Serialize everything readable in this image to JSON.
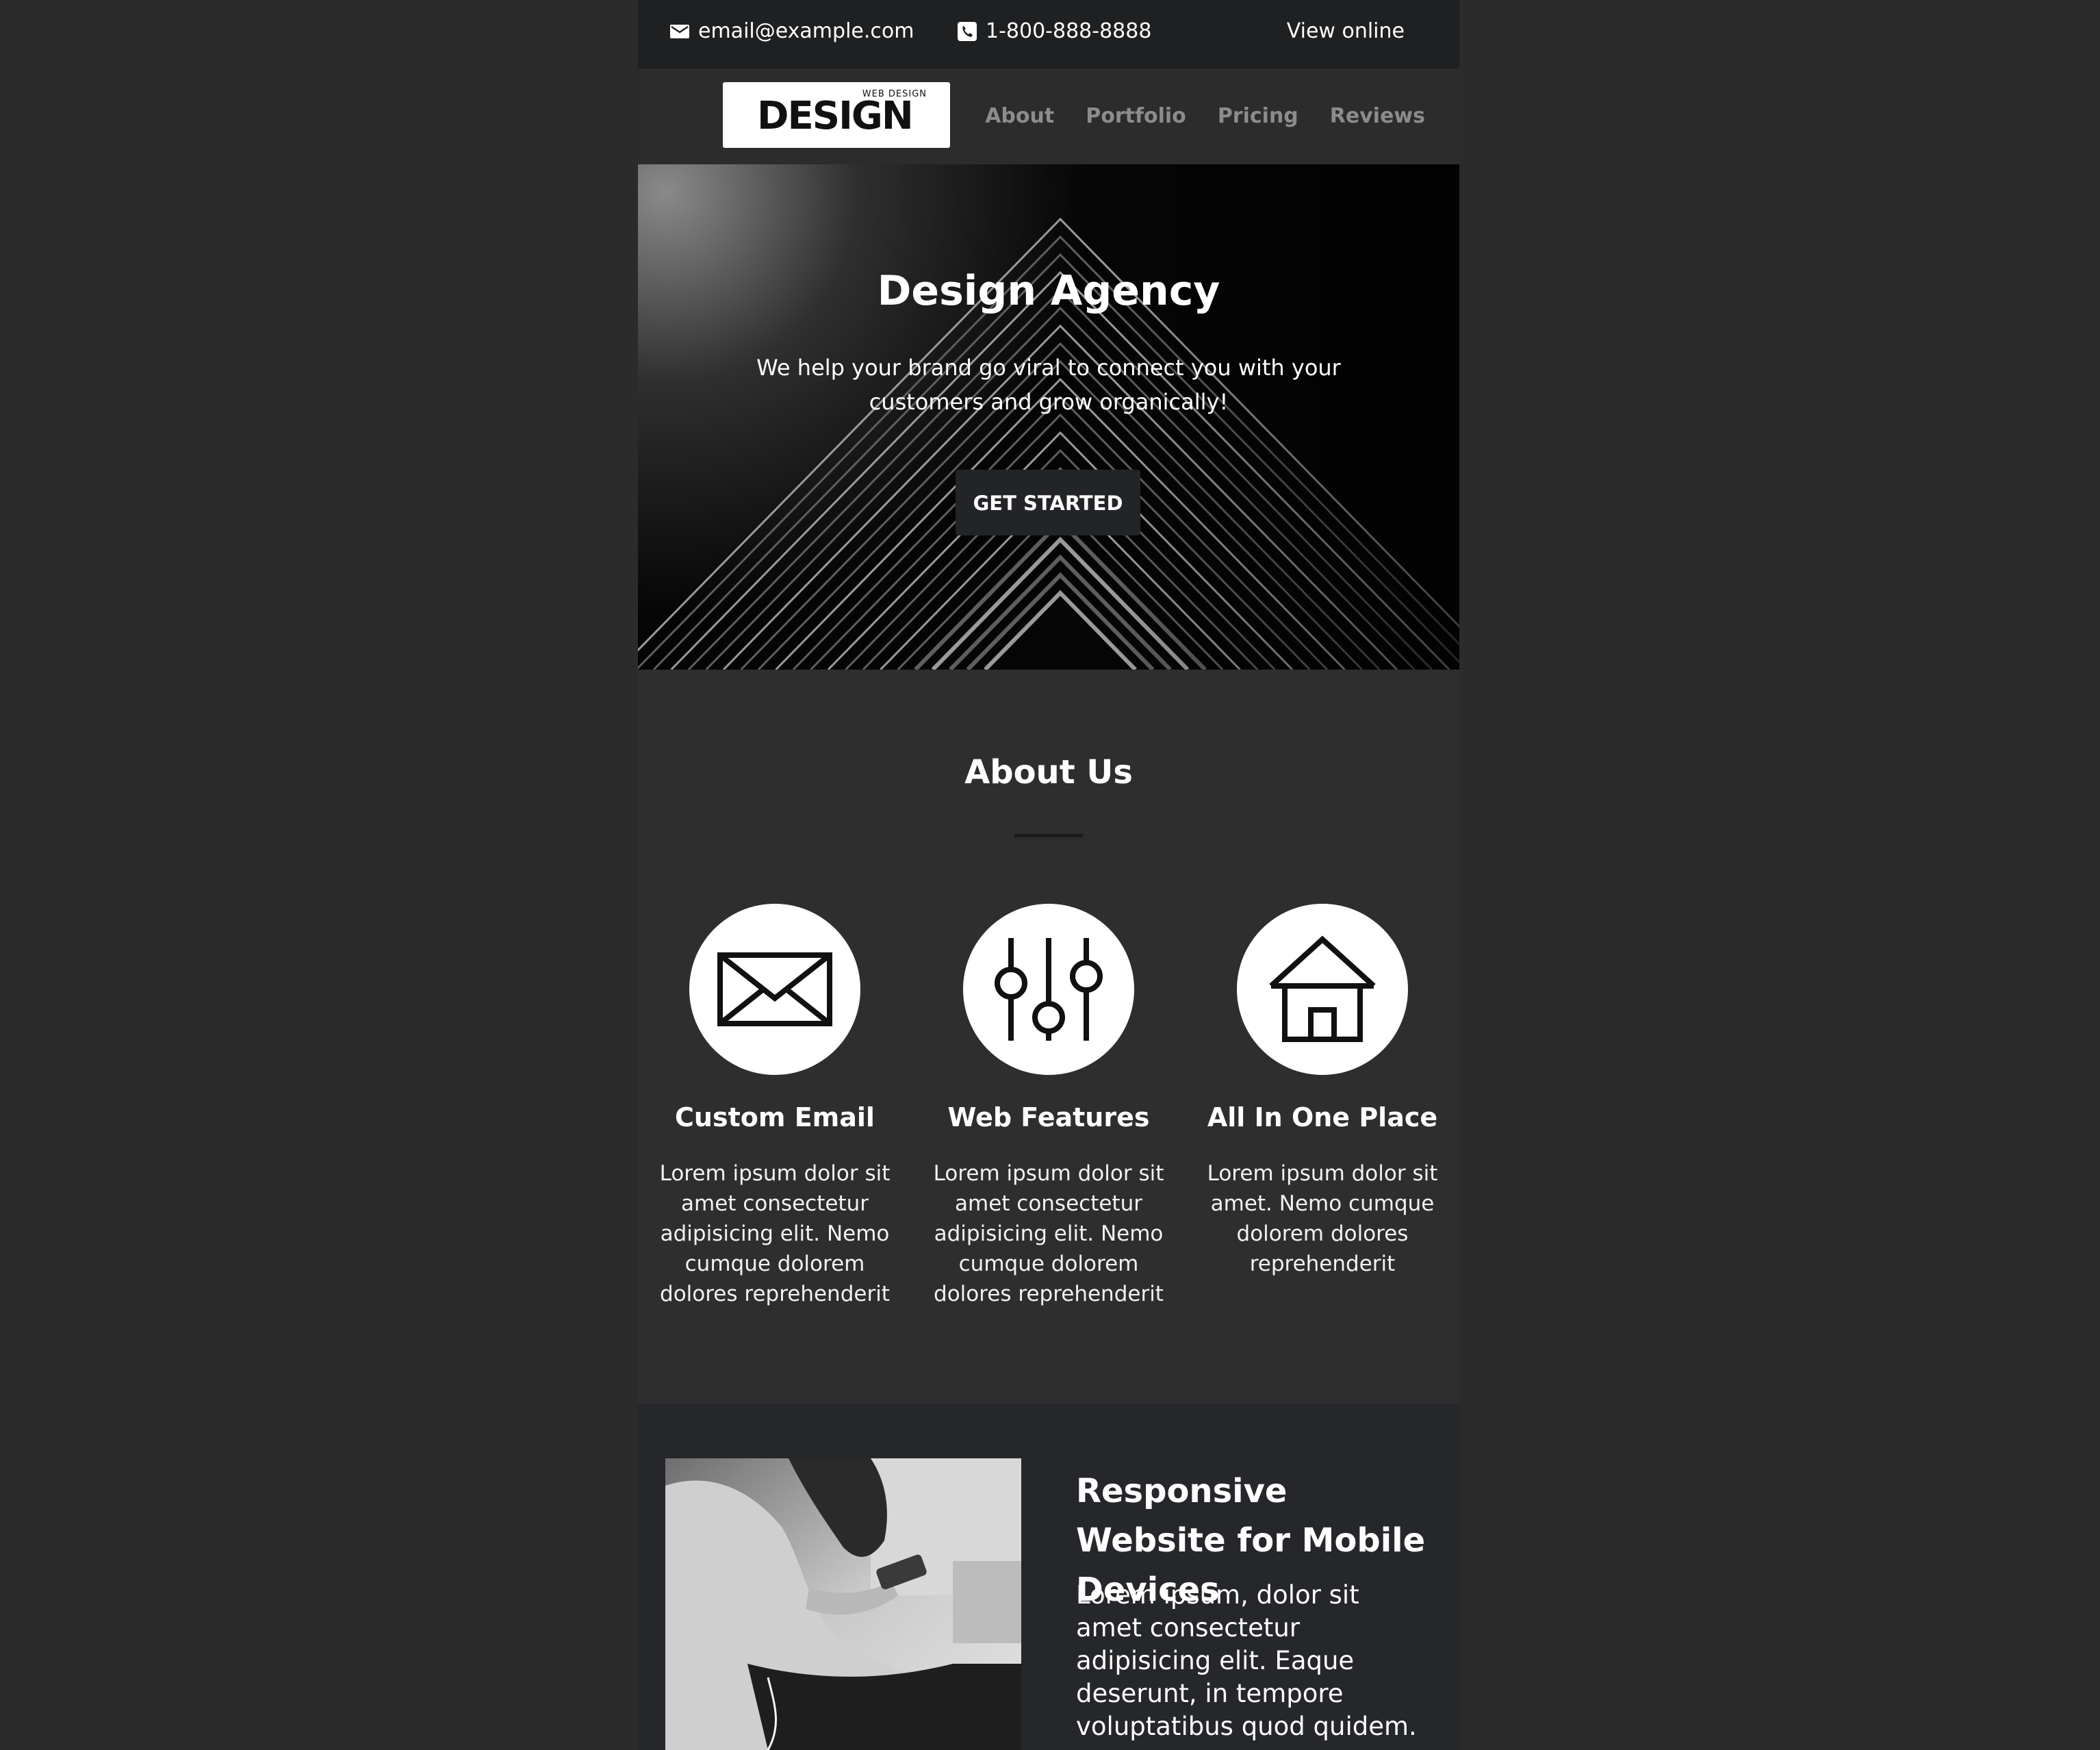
{
  "topbar": {
    "email": "email@example.com",
    "phone": "1-800-888-8888",
    "view_online": "View online"
  },
  "logo": {
    "text": "DESIGN",
    "arc_text": "WEB DESIGN"
  },
  "nav": {
    "items": [
      {
        "label": "About"
      },
      {
        "label": "Portfolio"
      },
      {
        "label": "Pricing"
      },
      {
        "label": "Reviews"
      }
    ]
  },
  "hero": {
    "title": "Design Agency",
    "subtitle": "We help your brand go viral to connect you with your customers and grow organically!",
    "button": "GET STARTED"
  },
  "about": {
    "title": "About Us",
    "features": [
      {
        "icon": "envelope-icon",
        "title": "Custom Email",
        "text": "Lorem ipsum dolor sit amet consectetur adipisicing elit. Nemo cumque dolorem dolores reprehenderit"
      },
      {
        "icon": "sliders-icon",
        "title": "Web Features",
        "text": "Lorem ipsum dolor sit amet consectetur adipisicing elit. Nemo cumque dolorem dolores reprehenderit"
      },
      {
        "icon": "house-icon",
        "title": "All In One Place",
        "text": "Lorem ipsum dolor sit amet. Nemo cumque dolorem dolores reprehenderit"
      }
    ]
  },
  "responsive": {
    "title": "Responsive Website for Mobile Devices",
    "text": "Lorem ipsum, dolor sit amet consectetur adipisicing elit. Eaque deserunt, in tempore voluptatibus quod quidem."
  },
  "colors": {
    "page_background": "#2b2b2b",
    "topbar_background": "#1f2022",
    "nav_link": "#8c8c8c",
    "button_background": "#232427"
  }
}
